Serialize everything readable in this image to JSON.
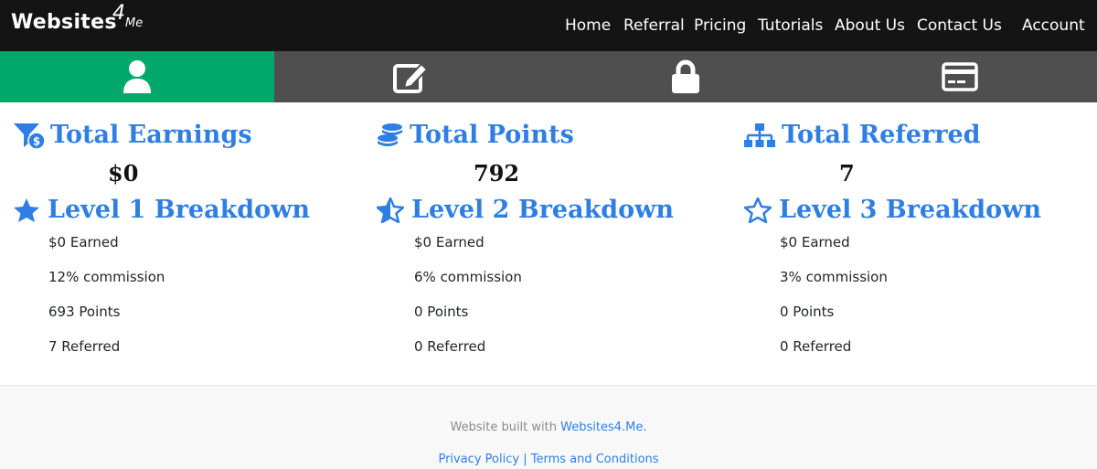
{
  "brand": {
    "name": "Websites",
    "num": "4",
    "suffix": "Me"
  },
  "nav": {
    "home": "Home",
    "referral": "Referral",
    "pricing": "Pricing",
    "tutorials": "Tutorials",
    "about": "About Us",
    "contact": "Contact Us",
    "account": "Account"
  },
  "tabs": [
    {
      "icon": "user-icon",
      "active": true
    },
    {
      "icon": "edit-icon",
      "active": false
    },
    {
      "icon": "lock-icon",
      "active": false
    },
    {
      "icon": "credit-card-icon",
      "active": false
    }
  ],
  "stats": {
    "earnings": {
      "label": "Total Earnings",
      "value": "$0",
      "icon": "funnel-dollar-icon"
    },
    "points": {
      "label": "Total Points",
      "value": "792",
      "icon": "coins-icon"
    },
    "referred": {
      "label": "Total Referred",
      "value": "7",
      "icon": "sitemap-icon"
    }
  },
  "levels": [
    {
      "title": "Level 1 Breakdown",
      "icon": "star-solid-icon",
      "earned": "$0 Earned",
      "commission": "12% commission",
      "points": "693 Points",
      "referred": "7 Referred"
    },
    {
      "title": "Level 2 Breakdown",
      "icon": "star-half-icon",
      "earned": "$0 Earned",
      "commission": "6% commission",
      "points": "0 Points",
      "referred": "0 Referred"
    },
    {
      "title": "Level 3 Breakdown",
      "icon": "star-outline-icon",
      "earned": "$0 Earned",
      "commission": "3% commission",
      "points": "0 Points",
      "referred": "0 Referred"
    }
  ],
  "footer": {
    "built_prefix": "Website built with ",
    "built_link": "Websites4.Me.",
    "privacy": "Privacy Policy",
    "separator": " | ",
    "terms": "Terms and Conditions"
  },
  "colors": {
    "accent": "#2f7fe3",
    "active_tab": "#00a86b",
    "tab_bar": "#4f4f4f",
    "navbar": "#141414"
  }
}
